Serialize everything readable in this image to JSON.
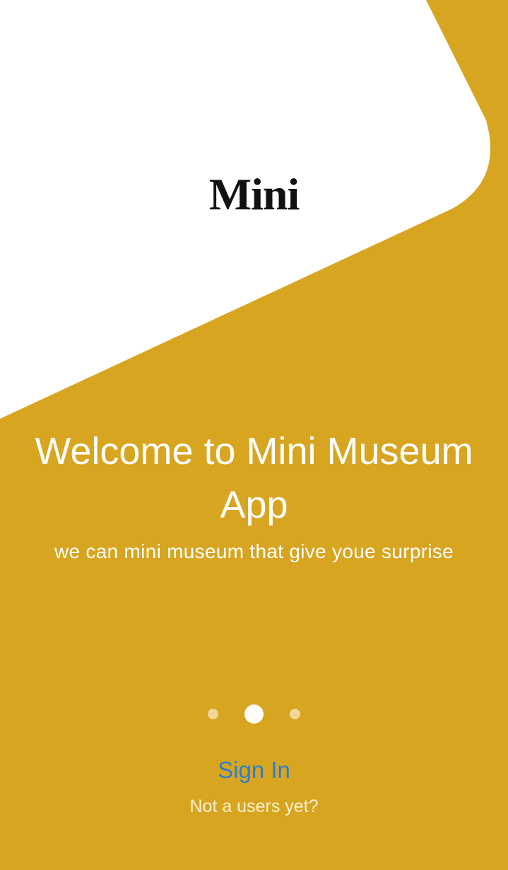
{
  "app": {
    "logo_text": "Mini"
  },
  "welcome": {
    "title_line1": "Welcome to Mini Museum",
    "title_line2": "App",
    "subtitle": "we can mini museum that give youe surprise"
  },
  "pager": {
    "total_pages": 3,
    "active_page": 2
  },
  "actions": {
    "sign_in_label": "Sign In",
    "not_user_label": "Not a users yet?"
  },
  "colors": {
    "background": "#D8A520",
    "card": "#FFFFFF",
    "link": "#2D7FCB",
    "dot_inactive": "#F2D79A",
    "dot_active": "#FFFFFF"
  }
}
